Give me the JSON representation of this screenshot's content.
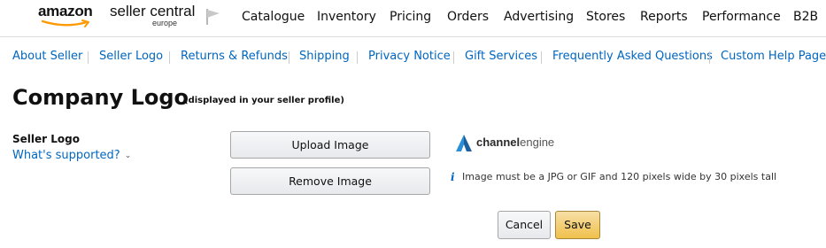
{
  "header": {
    "brand_amazon": "amazon",
    "brand_product": "seller central",
    "brand_region": "europe",
    "nav": [
      "Catalogue",
      "Inventory",
      "Pricing",
      "Orders",
      "Advertising",
      "Stores",
      "Reports",
      "Performance",
      "B2B"
    ]
  },
  "subnav": {
    "links": [
      "About Seller",
      "Seller Logo",
      "Returns & Refunds",
      "Shipping",
      "Privacy Notice",
      "Gift Services",
      "Frequently Asked Questions",
      "Custom Help Pages"
    ]
  },
  "page": {
    "title": "Company Logo",
    "subtitle": "(displayed in your seller profile)"
  },
  "form": {
    "field_label": "Seller Logo",
    "whats_supported": "What's supported?",
    "upload_button": "Upload Image",
    "remove_button": "Remove Image",
    "logo_preview": {
      "part1": "channel",
      "part2": "engine"
    },
    "info_text": "Image must be a JPG or GIF and 120 pixels wide by 30 pixels tall",
    "cancel_button": "Cancel",
    "save_button": "Save"
  },
  "colors": {
    "link": "#0066c0",
    "save_bg": "#f0c14b",
    "amazon_orange": "#ff9900"
  }
}
